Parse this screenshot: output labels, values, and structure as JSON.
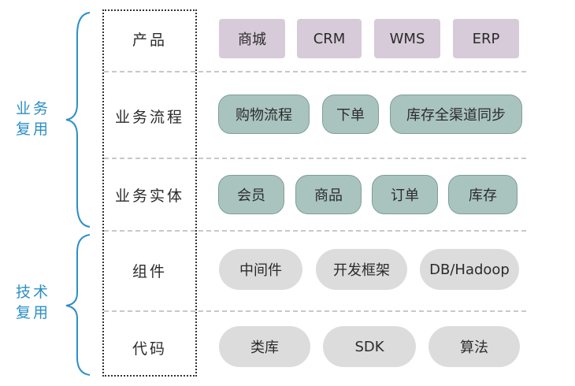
{
  "groups": {
    "business": {
      "line1": "业务",
      "line2": "复用"
    },
    "tech": {
      "line1": "技术",
      "line2": "复用"
    }
  },
  "layers": {
    "product": "产品",
    "flow": "业务流程",
    "entity": "业务实体",
    "component": "组件",
    "code": "代码"
  },
  "items": {
    "product": [
      "商城",
      "CRM",
      "WMS",
      "ERP"
    ],
    "flow": [
      "购物流程",
      "下单",
      "库存全渠道同步"
    ],
    "entity": [
      "会员",
      "商品",
      "订单",
      "库存"
    ],
    "component": [
      "中间件",
      "开发框架",
      "DB/Hadoop"
    ],
    "code": [
      "类库",
      "SDK",
      "算法"
    ]
  },
  "colors": {
    "group_label": "#2c8fc7",
    "product_fill": "#d7cad9",
    "business_fill": "#a9c4bf",
    "tech_fill": "#dcdcdc"
  }
}
